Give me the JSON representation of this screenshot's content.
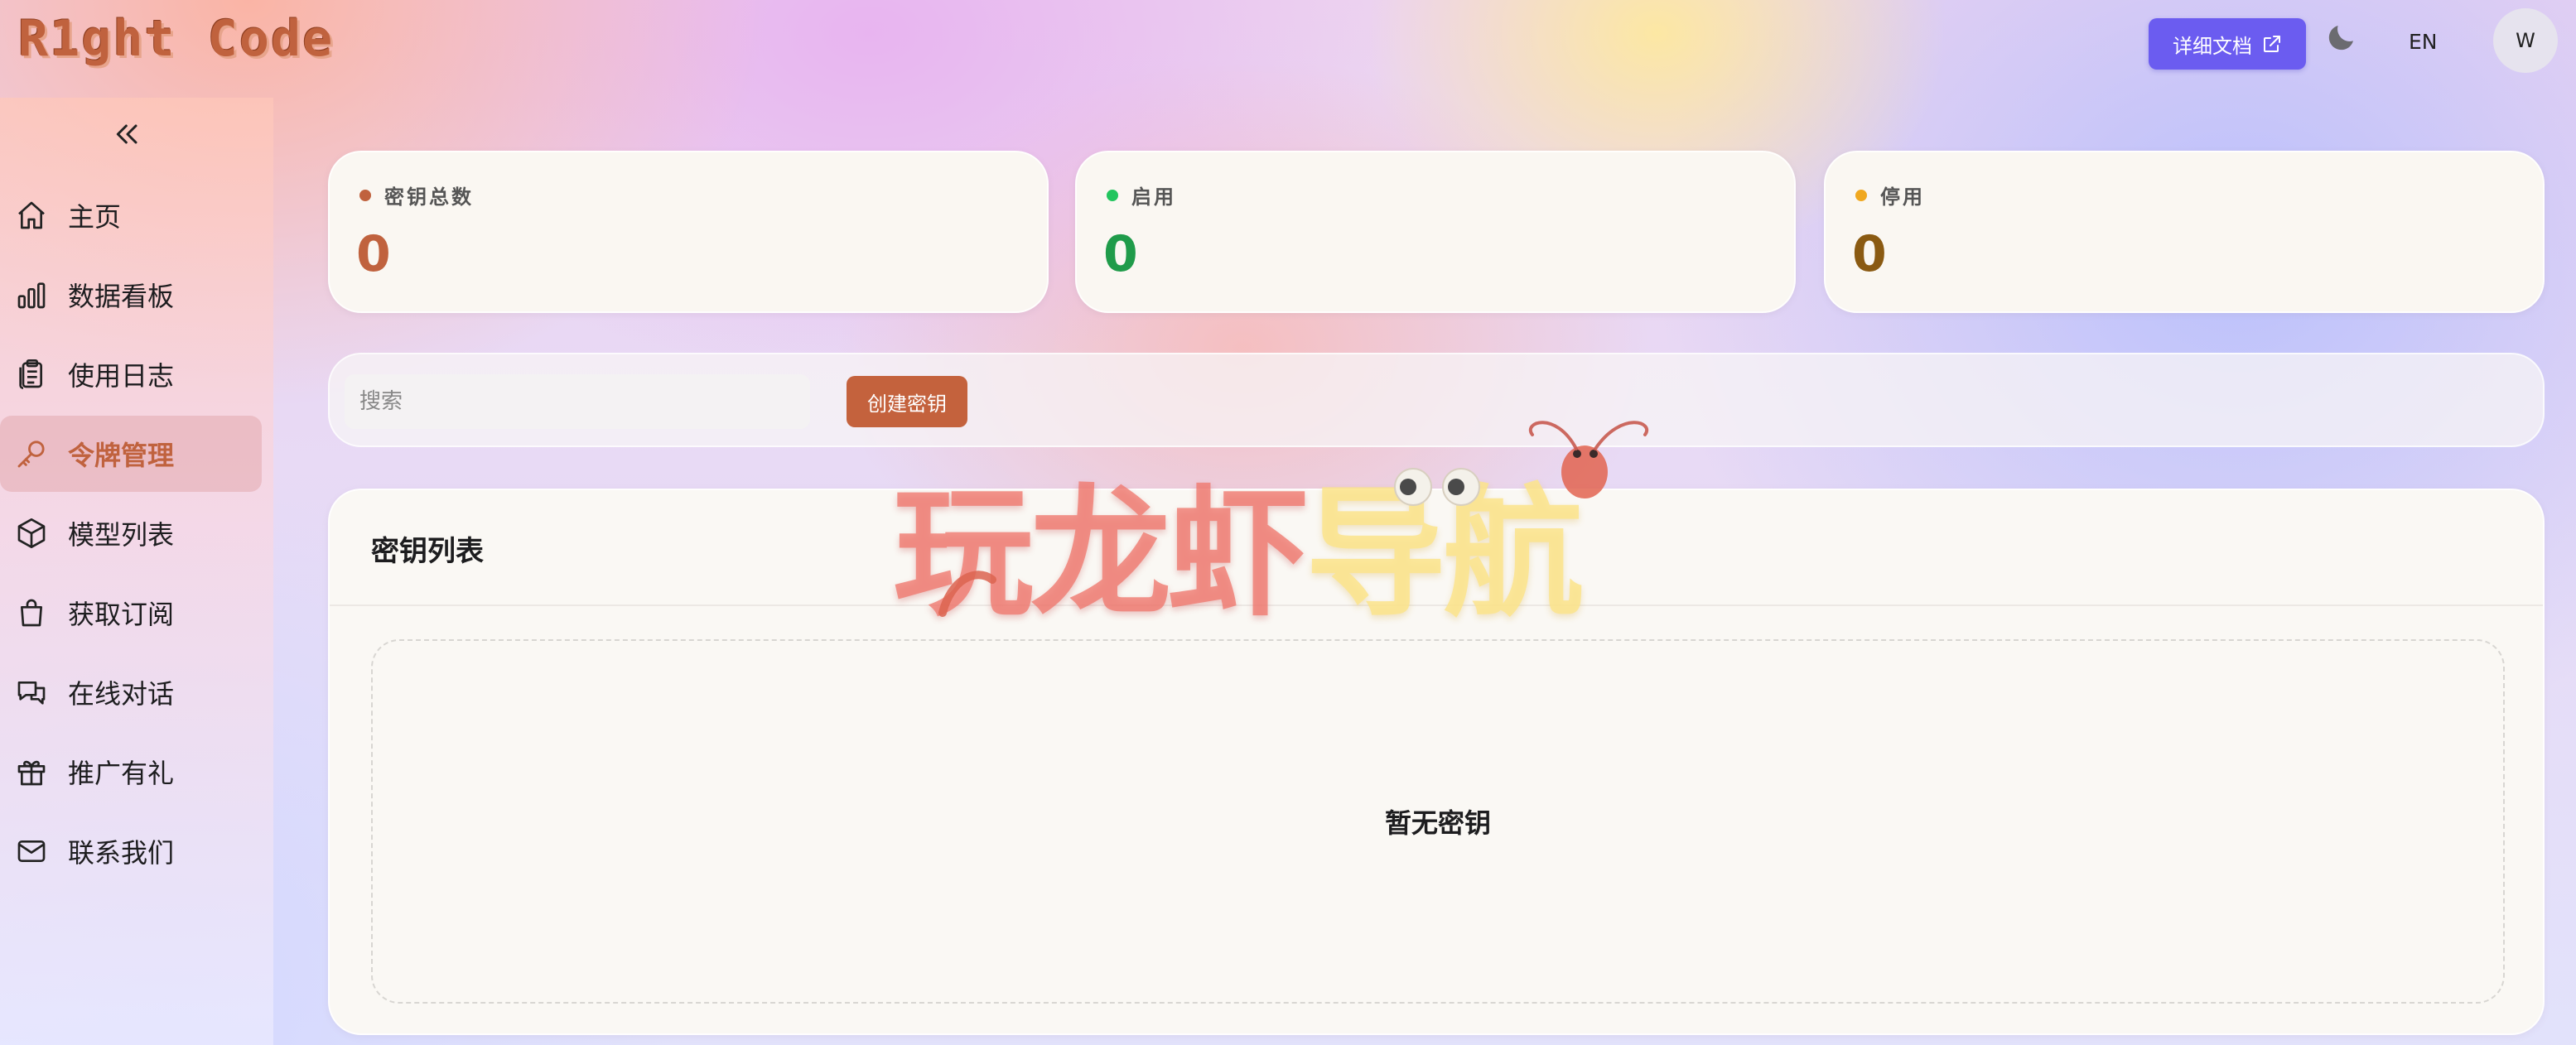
{
  "header": {
    "logo": "R1ght Code",
    "doc_button": "详细文档",
    "language": "EN",
    "avatar_initial": "W",
    "icons": {
      "external": "external-link-icon",
      "theme": "moon-icon"
    }
  },
  "sidebar": {
    "collapse_icon": "double-chevron-left-icon",
    "items": [
      {
        "label": "主页",
        "icon": "home-icon",
        "active": false
      },
      {
        "label": "数据看板",
        "icon": "bar-chart-icon",
        "active": false
      },
      {
        "label": "使用日志",
        "icon": "clipboard-icon",
        "active": false
      },
      {
        "label": "令牌管理",
        "icon": "key-icon",
        "active": true
      },
      {
        "label": "模型列表",
        "icon": "cube-icon",
        "active": false
      },
      {
        "label": "获取订阅",
        "icon": "shopping-bag-icon",
        "active": false
      },
      {
        "label": "在线对话",
        "icon": "chat-icon",
        "active": false
      },
      {
        "label": "推广有礼",
        "icon": "gift-icon",
        "active": false
      },
      {
        "label": "联系我们",
        "icon": "mail-icon",
        "active": false
      }
    ]
  },
  "stats": [
    {
      "label": "密钥总数",
      "value": "0",
      "dot_color": "#c0623e",
      "value_color": "#c0623e"
    },
    {
      "label": "启用",
      "value": "0",
      "dot_color": "#22c55e",
      "value_color": "#1f9b4a"
    },
    {
      "label": "停用",
      "value": "0",
      "dot_color": "#f0a820",
      "value_color": "#8a5a12"
    }
  ],
  "search": {
    "placeholder": "搜索",
    "value": "",
    "create_button": "创建密钥"
  },
  "key_list": {
    "title": "密钥列表",
    "empty_text": "暂无密钥"
  },
  "watermark": {
    "text_red": "玩龙虾",
    "text_yellow": "导航"
  },
  "colors": {
    "accent": "#c0623e",
    "doc_button": "#6b5cf0",
    "card_bg": "#faf7f2"
  }
}
